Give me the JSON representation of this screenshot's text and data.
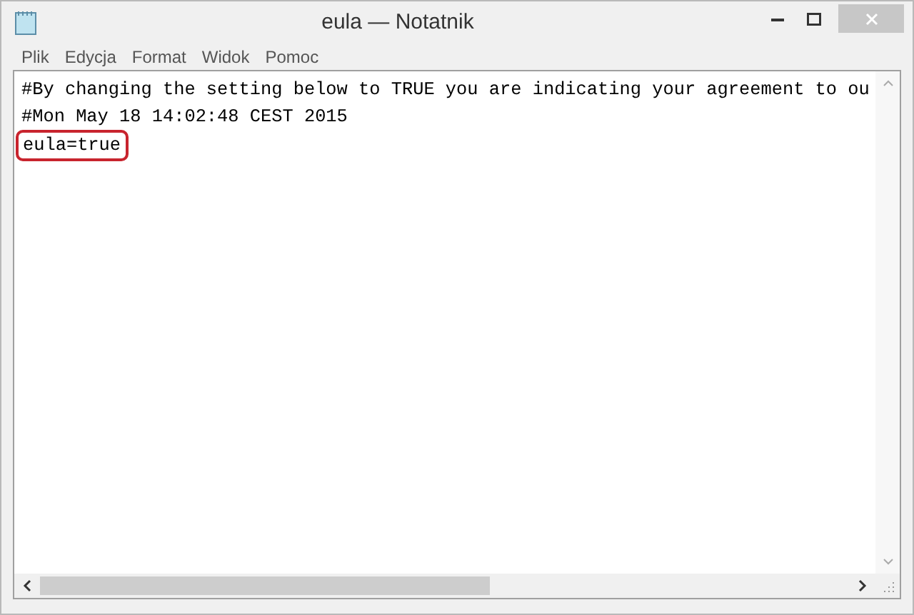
{
  "window": {
    "title": "eula — Notatnik"
  },
  "menu": [
    "Plik",
    "Edycja",
    "Format",
    "Widok",
    "Pomoc"
  ],
  "lines": [
    {
      "text": "#By changing the setting below to TRUE you are indicating your agreement to ou",
      "highlighted": false
    },
    {
      "text": "#Mon May 18 14:02:48 CEST 2015",
      "highlighted": false
    },
    {
      "text": "eula=true",
      "highlighted": true
    }
  ]
}
